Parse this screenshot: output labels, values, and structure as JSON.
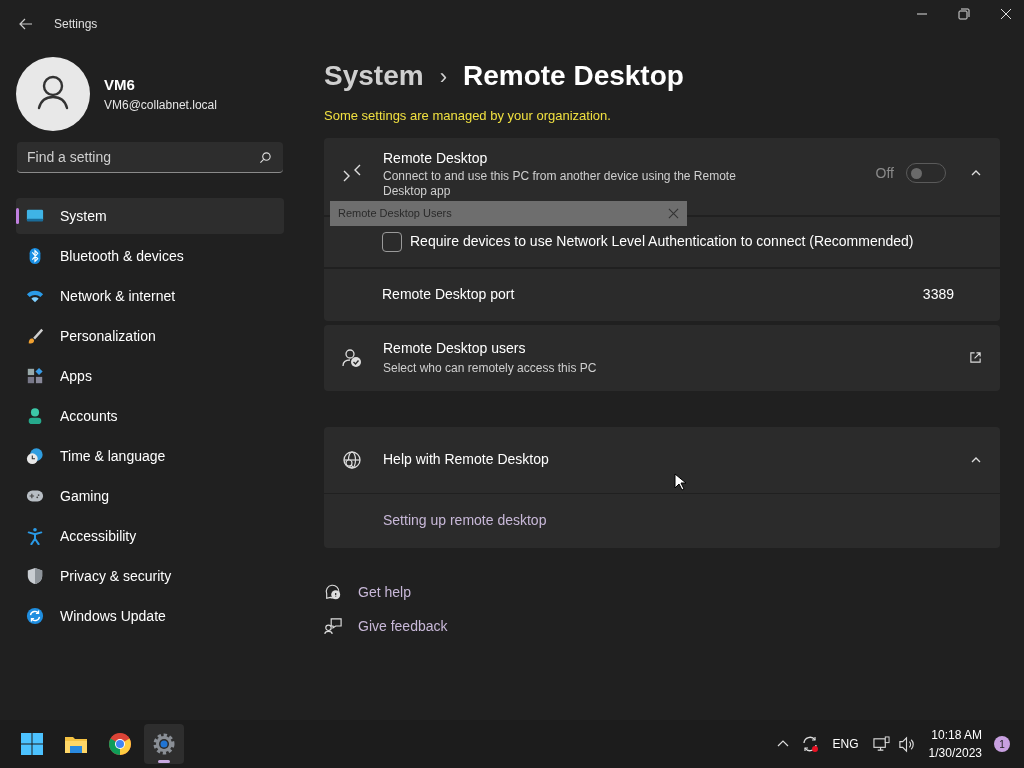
{
  "window": {
    "title": "Settings"
  },
  "account": {
    "name": "VM6",
    "email": "VM6@collabnet.local"
  },
  "search": {
    "placeholder": "Find a setting"
  },
  "sidebar": {
    "items": [
      {
        "label": "System",
        "selected": true
      },
      {
        "label": "Bluetooth & devices",
        "selected": false
      },
      {
        "label": "Network & internet",
        "selected": false
      },
      {
        "label": "Personalization",
        "selected": false
      },
      {
        "label": "Apps",
        "selected": false
      },
      {
        "label": "Accounts",
        "selected": false
      },
      {
        "label": "Time & language",
        "selected": false
      },
      {
        "label": "Gaming",
        "selected": false
      },
      {
        "label": "Accessibility",
        "selected": false
      },
      {
        "label": "Privacy & security",
        "selected": false
      },
      {
        "label": "Windows Update",
        "selected": false
      }
    ]
  },
  "breadcrumb": {
    "parent": "System",
    "separator": "›",
    "current": "Remote Desktop"
  },
  "notice": "Some settings are managed by your organization.",
  "remote_desktop": {
    "title": "Remote Desktop",
    "description": "Connect to and use this PC from another device using the Remote Desktop app",
    "toggle_label": "Off",
    "on": false,
    "expanded": true,
    "rows": [
      {
        "kind": "checkbox",
        "label": "Require devices to use Network Level Authentication to connect (Recommended)",
        "checked": false
      },
      {
        "kind": "value",
        "label": "Remote Desktop port",
        "value": "3389"
      }
    ]
  },
  "users_card": {
    "title": "Remote Desktop users",
    "description": "Select who can remotely access this PC"
  },
  "help": {
    "title": "Help with Remote Desktop",
    "expanded": true,
    "links": [
      "Setting up remote desktop"
    ]
  },
  "footer_links": [
    "Get help",
    "Give feedback"
  ],
  "dialog": {
    "title": "Remote Desktop Users"
  },
  "taskbar": {
    "apps": [
      {
        "selected": false
      },
      {
        "selected": false
      },
      {
        "selected": false
      },
      {
        "selected": true
      }
    ],
    "language": "ENG",
    "time": "10:18 AM",
    "date": "1/30/2023",
    "notifications": "1"
  }
}
